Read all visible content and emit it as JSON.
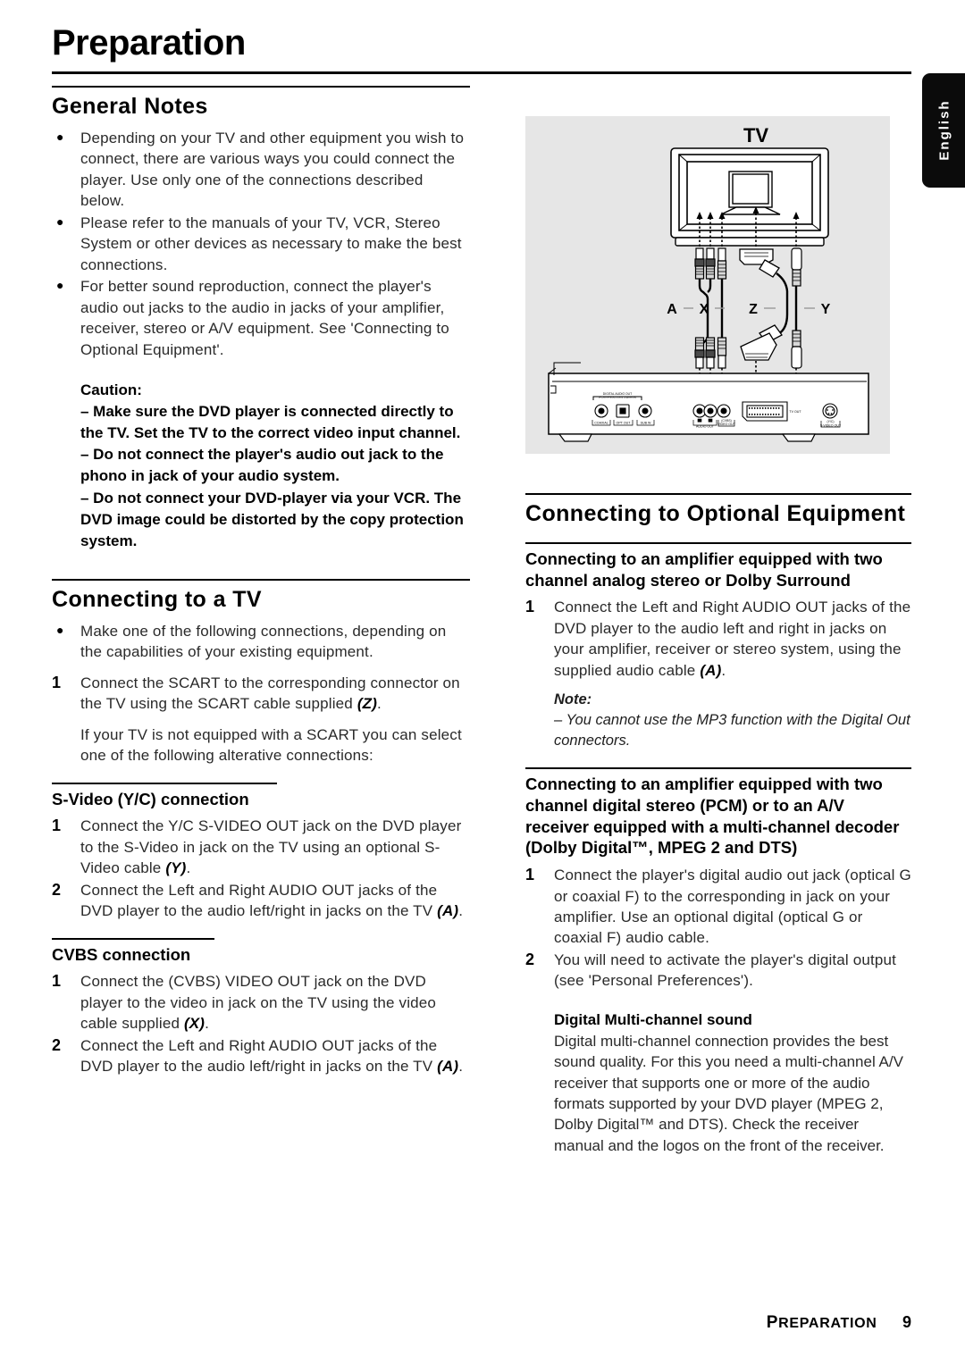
{
  "page_title": "Preparation",
  "language_tab": "English",
  "left_column": {
    "general_notes": {
      "heading": "General Notes",
      "bullets": [
        "Depending on your TV and other equipment you wish to connect, there are various ways you could connect the player. Use only one of the connections described below.",
        "Please refer to the manuals of your TV, VCR, Stereo System or other devices as necessary to make the best connections.",
        "For better sound reproduction, connect the player's audio out jacks to the audio in jacks of your amplifier, receiver, stereo or A/V equipment.  See 'Connecting to Optional Equipment'."
      ],
      "caution": {
        "title": "Caution:",
        "items": [
          "– Make sure the DVD player is connected directly to the TV. Set the TV to the correct video input channel.",
          "– Do not connect  the player's audio out jack to the phono in jack of your audio system.",
          "– Do not connect your DVD-player via your VCR. The DVD image could be distorted by the copy protection system."
        ]
      }
    },
    "connecting_tv": {
      "heading": "Connecting to a TV",
      "bullets": [
        "Make one of the following connections, depending on the capabilities of your existing equipment."
      ],
      "steps": [
        {
          "num": "1",
          "text": "Connect the SCART to the corresponding connector on the TV using the SCART cable supplied ",
          "ref": "(Z)",
          "tail": "."
        }
      ],
      "note_paragraph": "If your TV is not equipped with a SCART you can select one of the following alterative connections:",
      "svideo": {
        "heading": "S-Video (Y/C) connection",
        "steps": [
          {
            "num": "1",
            "text": "Connect the Y/C S-VIDEO OUT jack on the DVD player to the S-Video in jack on the TV using an optional S-Video cable ",
            "ref": "(Y)",
            "tail": "."
          },
          {
            "num": "2",
            "text": "Connect the Left and Right AUDIO OUT jacks of the DVD player to the audio left/right in jacks on the TV ",
            "ref": "(A)",
            "tail": "."
          }
        ]
      },
      "cvbs": {
        "heading": "CVBS connection",
        "steps": [
          {
            "num": "1",
            "text": "Connect the (CVBS) VIDEO OUT jack on the DVD player to the video in jack on the TV using the video cable supplied ",
            "ref": "(X)",
            "tail": "."
          },
          {
            "num": "2",
            "text": "Connect the Left and Right AUDIO OUT jacks of the DVD player to the audio left/right in jacks on the TV ",
            "ref": "(A)",
            "tail": "."
          }
        ]
      }
    }
  },
  "right_column": {
    "optional_equipment": {
      "heading": "Connecting to Optional Equipment",
      "analog": {
        "heading": "Connecting to an amplifier equipped with two channel analog  stereo or Dolby Surround",
        "steps": [
          {
            "num": "1",
            "text": "Connect the Left and Right AUDIO OUT jacks of the DVD player to the audio left and right in jacks on your amplifier, receiver or stereo system, using the supplied audio cable ",
            "ref": "(A)",
            "tail": "."
          }
        ],
        "note_label": "Note:",
        "note_text": "– You cannot use the MP3 function with the Digital Out connectors."
      },
      "digital": {
        "heading": "Connecting to an amplifier equipped with two channel digital stereo (PCM) or to an A/V receiver equipped with a multi-channel decoder (Dolby Digital™, MPEG 2 and DTS)",
        "steps": [
          {
            "num": "1",
            "text": "Connect the player's digital audio out jack (optical G or coaxial F) to the corresponding in jack on your amplifier. Use an optional digital (optical G or coaxial F) audio cable."
          },
          {
            "num": "2",
            "text": "You will need to activate the player's digital output (see 'Personal Preferences')."
          }
        ],
        "multichannel": {
          "heading": "Digital Multi-channel sound",
          "body": "Digital multi-channel connection provides the best sound quality. For this you need a multi-channel A/V receiver that supports one or more of the audio formats supported by your DVD player (MPEG 2, Dolby Digital™ and DTS). Check the receiver manual and the logos on the front of the receiver."
        }
      }
    }
  },
  "diagram": {
    "tv_label": "TV",
    "cable_labels": [
      "A",
      "X",
      "Z",
      "Y"
    ],
    "panel_labels": {
      "digital_audio_out": "DIGITAL AUDIO OUT",
      "pcm_group": "(PCM / MPEG2 / Dolby Digital / dts)",
      "coaxial": "COAXIAL",
      "opt_out": "OPT OUT",
      "sub_w": "SUB W",
      "audio_out": "AUDIO OUT",
      "audio_l": "L",
      "audio_r": "R",
      "video_out": "VIDEO OUT",
      "cvbs": "(CVBS)",
      "tv_out": "TV OUT",
      "s_video_out": "S-VIDEO OUT",
      "yc": "(Y/C)"
    }
  },
  "footer": {
    "chapter_first": "P",
    "chapter_rest": "REPARATION",
    "page_number": "9"
  }
}
